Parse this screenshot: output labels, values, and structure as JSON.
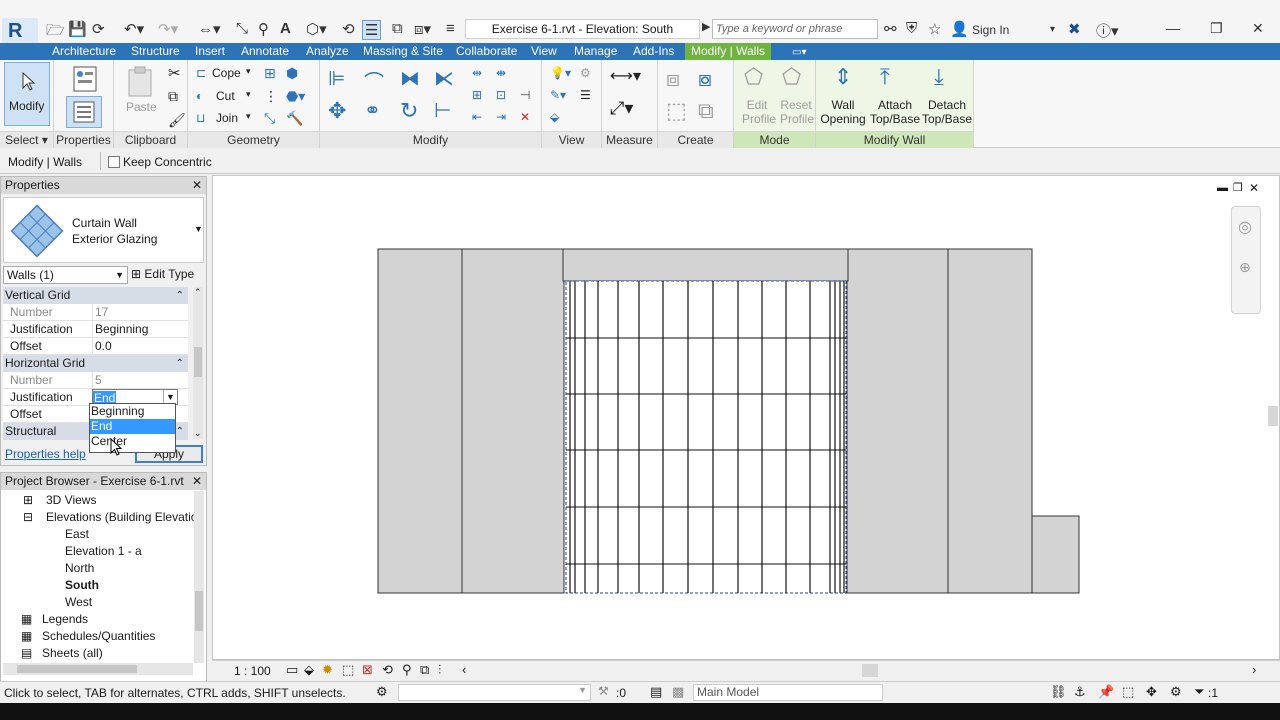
{
  "app": {
    "logo_letter": "R",
    "document_title": "Exercise 6-1.rvt - Elevation: South",
    "search_placeholder": "Type a keyword or phrase",
    "sign_in": "Sign In"
  },
  "tabs": [
    "Architecture",
    "Structure",
    "Insert",
    "Annotate",
    "Analyze",
    "Massing & Site",
    "Collaborate",
    "View",
    "Manage",
    "Add-Ins",
    "Modify | Walls"
  ],
  "ribbon": {
    "select": {
      "modify_label": "Modify",
      "title": "Select ▾"
    },
    "properties": {
      "title": "Properties"
    },
    "clipboard": {
      "paste": "Paste",
      "title": "Clipboard"
    },
    "geometry": {
      "cope": "Cope",
      "cut": "Cut",
      "join": "Join",
      "title": "Geometry"
    },
    "modify": {
      "title": "Modify"
    },
    "view": {
      "title": "View"
    },
    "measure": {
      "title": "Measure"
    },
    "create": {
      "title": "Create"
    },
    "mode": {
      "edit_profile": "Edit Profile",
      "reset_profile": "Reset Profile",
      "title": "Mode"
    },
    "modify_wall": {
      "wall_opening": "Wall Opening",
      "attach": "Attach Top/Base",
      "detach": "Detach Top/Base",
      "title": "Modify Wall"
    }
  },
  "options_bar": {
    "context": "Modify | Walls",
    "keep_concentric": "Keep Concentric"
  },
  "properties": {
    "header": "Properties",
    "family": "Curtain Wall",
    "type": "Exterior Glazing",
    "selector": "Walls (1)",
    "edit_type": "Edit Type",
    "groups": {
      "vertical_grid": "Vertical Grid",
      "horizontal_grid": "Horizontal Grid",
      "structural": "Structural"
    },
    "rows": {
      "v_number": {
        "k": "Number",
        "v": "17"
      },
      "v_justification": {
        "k": "Justification",
        "v": "Beginning"
      },
      "v_offset": {
        "k": "Offset",
        "v": "0.0"
      },
      "h_number": {
        "k": "Number",
        "v": "5"
      },
      "h_justification": {
        "k": "Justification",
        "v": "End"
      },
      "h_offset": {
        "k": "Offset",
        "v": ""
      }
    },
    "dropdown_options": [
      "Beginning",
      "End",
      "Center"
    ],
    "help_link": "Properties help",
    "apply": "Apply"
  },
  "browser": {
    "header": "Project Browser - Exercise 6-1.rvt",
    "items": {
      "views3d": "3D Views",
      "elevations": "Elevations (Building Elevation",
      "east": "East",
      "elev1a": "Elevation 1 - a",
      "north": "North",
      "south": "South",
      "west": "West",
      "legends": "Legends",
      "schedules": "Schedules/Quantities",
      "sheets": "Sheets (all)"
    }
  },
  "view_bar": {
    "scale": "1 : 100"
  },
  "status": {
    "hint": "Click to select, TAB for alternates, CTRL adds, SHIFT unselects.",
    "count": ":0",
    "model": "Main Model",
    "filter": ":1"
  }
}
